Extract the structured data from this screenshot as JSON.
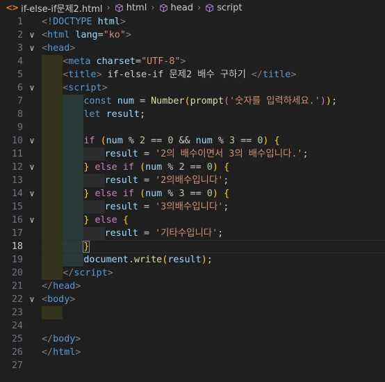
{
  "breadcrumb": {
    "file_icon": "<>",
    "file": "if-else-if문제2.html",
    "items": [
      "html",
      "head",
      "script"
    ]
  },
  "colors": {
    "tag": "#569cd6",
    "attr": "#9cdcfe",
    "string": "#ce9178",
    "keyword": "#569cd6",
    "control": "#c586c0",
    "function": "#dcdcaa",
    "variable": "#9cdcfe",
    "number": "#b5cea8",
    "text": "#cccccc",
    "bracket_gold": "#ffd700",
    "bracket_purple": "#da70d6",
    "bracket_blue": "#179fff",
    "punct": "#808080"
  },
  "current_line": 18,
  "lines": [
    {
      "n": "1",
      "fold": "",
      "indent": 0,
      "tokens": [
        [
          "<!",
          "punct"
        ],
        [
          "DOCTYPE",
          "tag"
        ],
        [
          " html",
          "attr"
        ],
        [
          ">",
          "punct"
        ]
      ]
    },
    {
      "n": "2",
      "fold": "v",
      "indent": 0,
      "tokens": [
        [
          "<",
          "punct"
        ],
        [
          "html",
          "tag"
        ],
        [
          " lang",
          "attr"
        ],
        [
          "=",
          "text"
        ],
        [
          "\"ko\"",
          "string"
        ],
        [
          ">",
          "punct"
        ]
      ]
    },
    {
      "n": "3",
      "fold": "v",
      "indent": 0,
      "tokens": [
        [
          "<",
          "punct"
        ],
        [
          "head",
          "tag"
        ],
        [
          ">",
          "punct"
        ]
      ]
    },
    {
      "n": "4",
      "fold": "",
      "indent": 1,
      "tokens": [
        [
          "<",
          "punct"
        ],
        [
          "meta",
          "tag"
        ],
        [
          " charset",
          "attr"
        ],
        [
          "=",
          "text"
        ],
        [
          "\"UTF-8\"",
          "string"
        ],
        [
          ">",
          "punct"
        ]
      ]
    },
    {
      "n": "5",
      "fold": "",
      "indent": 1,
      "tokens": [
        [
          "<",
          "punct"
        ],
        [
          "title",
          "tag"
        ],
        [
          ">",
          "punct"
        ],
        [
          " if-else-if 문제2 배수 구하기 ",
          "text"
        ],
        [
          "</",
          "punct"
        ],
        [
          "title",
          "tag"
        ],
        [
          ">",
          "punct"
        ]
      ]
    },
    {
      "n": "6",
      "fold": "v",
      "indent": 1,
      "tokens": [
        [
          "<",
          "punct"
        ],
        [
          "script",
          "tag"
        ],
        [
          ">",
          "punct"
        ]
      ]
    },
    {
      "n": "7",
      "fold": "",
      "indent": 2,
      "tokens": [
        [
          "const",
          "keyword"
        ],
        [
          " ",
          "text"
        ],
        [
          "num",
          "variable"
        ],
        [
          " = ",
          "text"
        ],
        [
          "Number",
          "function"
        ],
        [
          "(",
          "bracket_gold"
        ],
        [
          "prompt",
          "function"
        ],
        [
          "(",
          "bracket_purple"
        ],
        [
          "'숫자를 입력하세요.'",
          "string"
        ],
        [
          ")",
          "bracket_purple"
        ],
        [
          ")",
          "bracket_gold"
        ],
        [
          ";",
          "text"
        ]
      ]
    },
    {
      "n": "8",
      "fold": "",
      "indent": 2,
      "tokens": [
        [
          "let",
          "keyword"
        ],
        [
          " ",
          "text"
        ],
        [
          "result",
          "variable"
        ],
        [
          ";",
          "text"
        ]
      ]
    },
    {
      "n": "9",
      "fold": "",
      "indent": 2,
      "tokens": []
    },
    {
      "n": "10",
      "fold": "v",
      "indent": 2,
      "tokens": [
        [
          "if",
          "control"
        ],
        [
          " ",
          "text"
        ],
        [
          "(",
          "bracket_gold"
        ],
        [
          "num",
          "variable"
        ],
        [
          " % ",
          "text"
        ],
        [
          "2",
          "number"
        ],
        [
          " == ",
          "text"
        ],
        [
          "0",
          "number"
        ],
        [
          " && ",
          "text"
        ],
        [
          "num",
          "variable"
        ],
        [
          " % ",
          "text"
        ],
        [
          "3",
          "number"
        ],
        [
          " == ",
          "text"
        ],
        [
          "0",
          "number"
        ],
        [
          ")",
          "bracket_gold"
        ],
        [
          " ",
          "text"
        ],
        [
          "{",
          "bracket_gold"
        ]
      ]
    },
    {
      "n": "11",
      "fold": "",
      "indent": 3,
      "tokens": [
        [
          "result",
          "variable"
        ],
        [
          " = ",
          "text"
        ],
        [
          "'2의 배수이면서 3의 배수입니다.'",
          "string"
        ],
        [
          ";",
          "text"
        ]
      ]
    },
    {
      "n": "12",
      "fold": "v",
      "indent": 2,
      "tokens": [
        [
          "}",
          "bracket_gold"
        ],
        [
          " ",
          "text"
        ],
        [
          "else",
          "control"
        ],
        [
          " ",
          "text"
        ],
        [
          "if",
          "control"
        ],
        [
          " ",
          "text"
        ],
        [
          "(",
          "bracket_gold"
        ],
        [
          "num",
          "variable"
        ],
        [
          " % ",
          "text"
        ],
        [
          "2",
          "number"
        ],
        [
          " == ",
          "text"
        ],
        [
          "0",
          "number"
        ],
        [
          ")",
          "bracket_gold"
        ],
        [
          " ",
          "text"
        ],
        [
          "{",
          "bracket_gold"
        ]
      ]
    },
    {
      "n": "13",
      "fold": "",
      "indent": 3,
      "tokens": [
        [
          "result",
          "variable"
        ],
        [
          " = ",
          "text"
        ],
        [
          "'2의배수입니다'",
          "string"
        ],
        [
          ";",
          "text"
        ]
      ]
    },
    {
      "n": "14",
      "fold": "v",
      "indent": 2,
      "tokens": [
        [
          "}",
          "bracket_gold"
        ],
        [
          " ",
          "text"
        ],
        [
          "else",
          "control"
        ],
        [
          " ",
          "text"
        ],
        [
          "if",
          "control"
        ],
        [
          " ",
          "text"
        ],
        [
          "(",
          "bracket_gold"
        ],
        [
          "num",
          "variable"
        ],
        [
          " % ",
          "text"
        ],
        [
          "3",
          "number"
        ],
        [
          " == ",
          "text"
        ],
        [
          "0",
          "number"
        ],
        [
          ")",
          "bracket_gold"
        ],
        [
          " ",
          "text"
        ],
        [
          "{",
          "bracket_gold"
        ]
      ]
    },
    {
      "n": "15",
      "fold": "",
      "indent": 3,
      "tokens": [
        [
          "result",
          "variable"
        ],
        [
          " = ",
          "text"
        ],
        [
          "'3의배수입니다'",
          "string"
        ],
        [
          ";",
          "text"
        ]
      ]
    },
    {
      "n": "16",
      "fold": "v",
      "indent": 2,
      "tokens": [
        [
          "}",
          "bracket_gold"
        ],
        [
          " ",
          "text"
        ],
        [
          "else",
          "control"
        ],
        [
          " ",
          "text"
        ],
        [
          "{",
          "bracket_gold"
        ]
      ]
    },
    {
      "n": "17",
      "fold": "",
      "indent": 3,
      "tokens": [
        [
          "result",
          "variable"
        ],
        [
          " = ",
          "text"
        ],
        [
          "'기타수입니다'",
          "string"
        ],
        [
          ";",
          "text"
        ]
      ]
    },
    {
      "n": "18",
      "fold": "",
      "indent": 2,
      "tokens": [
        [
          "}",
          "bracket_gold"
        ]
      ]
    },
    {
      "n": "19",
      "fold": "",
      "indent": 2,
      "tokens": [
        [
          "document",
          "variable"
        ],
        [
          ".",
          "text"
        ],
        [
          "write",
          "function"
        ],
        [
          "(",
          "bracket_gold"
        ],
        [
          "result",
          "variable"
        ],
        [
          ")",
          "bracket_gold"
        ],
        [
          ";",
          "text"
        ]
      ]
    },
    {
      "n": "20",
      "fold": "",
      "indent": 1,
      "tokens": [
        [
          "</",
          "punct"
        ],
        [
          "script",
          "tag"
        ],
        [
          ">",
          "punct"
        ]
      ]
    },
    {
      "n": "21",
      "fold": "",
      "indent": 0,
      "tokens": [
        [
          "</",
          "punct"
        ],
        [
          "head",
          "tag"
        ],
        [
          ">",
          "punct"
        ]
      ]
    },
    {
      "n": "22",
      "fold": "v",
      "indent": 0,
      "tokens": [
        [
          "<",
          "punct"
        ],
        [
          "body",
          "tag"
        ],
        [
          ">",
          "punct"
        ]
      ]
    },
    {
      "n": "23",
      "fold": "",
      "indent": 1,
      "tokens": []
    },
    {
      "n": "24",
      "fold": "",
      "indent": 0,
      "tokens": []
    },
    {
      "n": "25",
      "fold": "",
      "indent": 0,
      "tokens": [
        [
          "</",
          "punct"
        ],
        [
          "body",
          "tag"
        ],
        [
          ">",
          "punct"
        ]
      ]
    },
    {
      "n": "26",
      "fold": "",
      "indent": 0,
      "tokens": [
        [
          "</",
          "punct"
        ],
        [
          "html",
          "tag"
        ],
        [
          ">",
          "punct"
        ]
      ]
    },
    {
      "n": "27",
      "fold": "",
      "indent": 0,
      "tokens": []
    }
  ]
}
